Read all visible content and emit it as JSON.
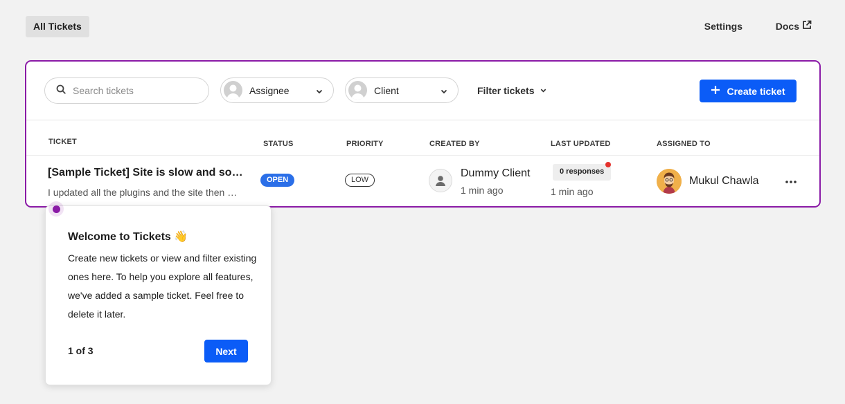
{
  "topbar": {
    "tab_all": "All Tickets",
    "settings": "Settings",
    "docs": "Docs"
  },
  "toolbar": {
    "search_placeholder": "Search tickets",
    "assignee": "Assignee",
    "client": "Client",
    "filter": "Filter tickets",
    "create": "Create ticket"
  },
  "table": {
    "headers": {
      "ticket": "TICKET",
      "status": "STATUS",
      "priority": "PRIORITY",
      "created_by": "CREATED BY",
      "last_updated": "LAST UPDATED",
      "assigned_to": "ASSIGNED TO"
    },
    "rows": [
      {
        "title": "[Sample Ticket] Site is slow and sometimes crashes",
        "excerpt": "I updated all the plugins and the site then started crashing",
        "status": "OPEN",
        "priority": "LOW",
        "created_by": "Dummy Client",
        "created_time": "1 min ago",
        "responses": "0 responses",
        "updated_time": "1 min ago",
        "assignee": "Mukul Chawla"
      }
    ]
  },
  "tour": {
    "title": "Welcome to Tickets 👋",
    "body": "Create new tickets or view and filter existing ones here. To help you explore all features, we've added a sample ticket. Feel free to delete it later.",
    "step": "1 of 3",
    "next": "Next"
  },
  "colors": {
    "accent": "#0b5cf7",
    "highlight": "#8a1aa6",
    "status_open": "#2b6fe8",
    "notification": "#e5322d"
  }
}
